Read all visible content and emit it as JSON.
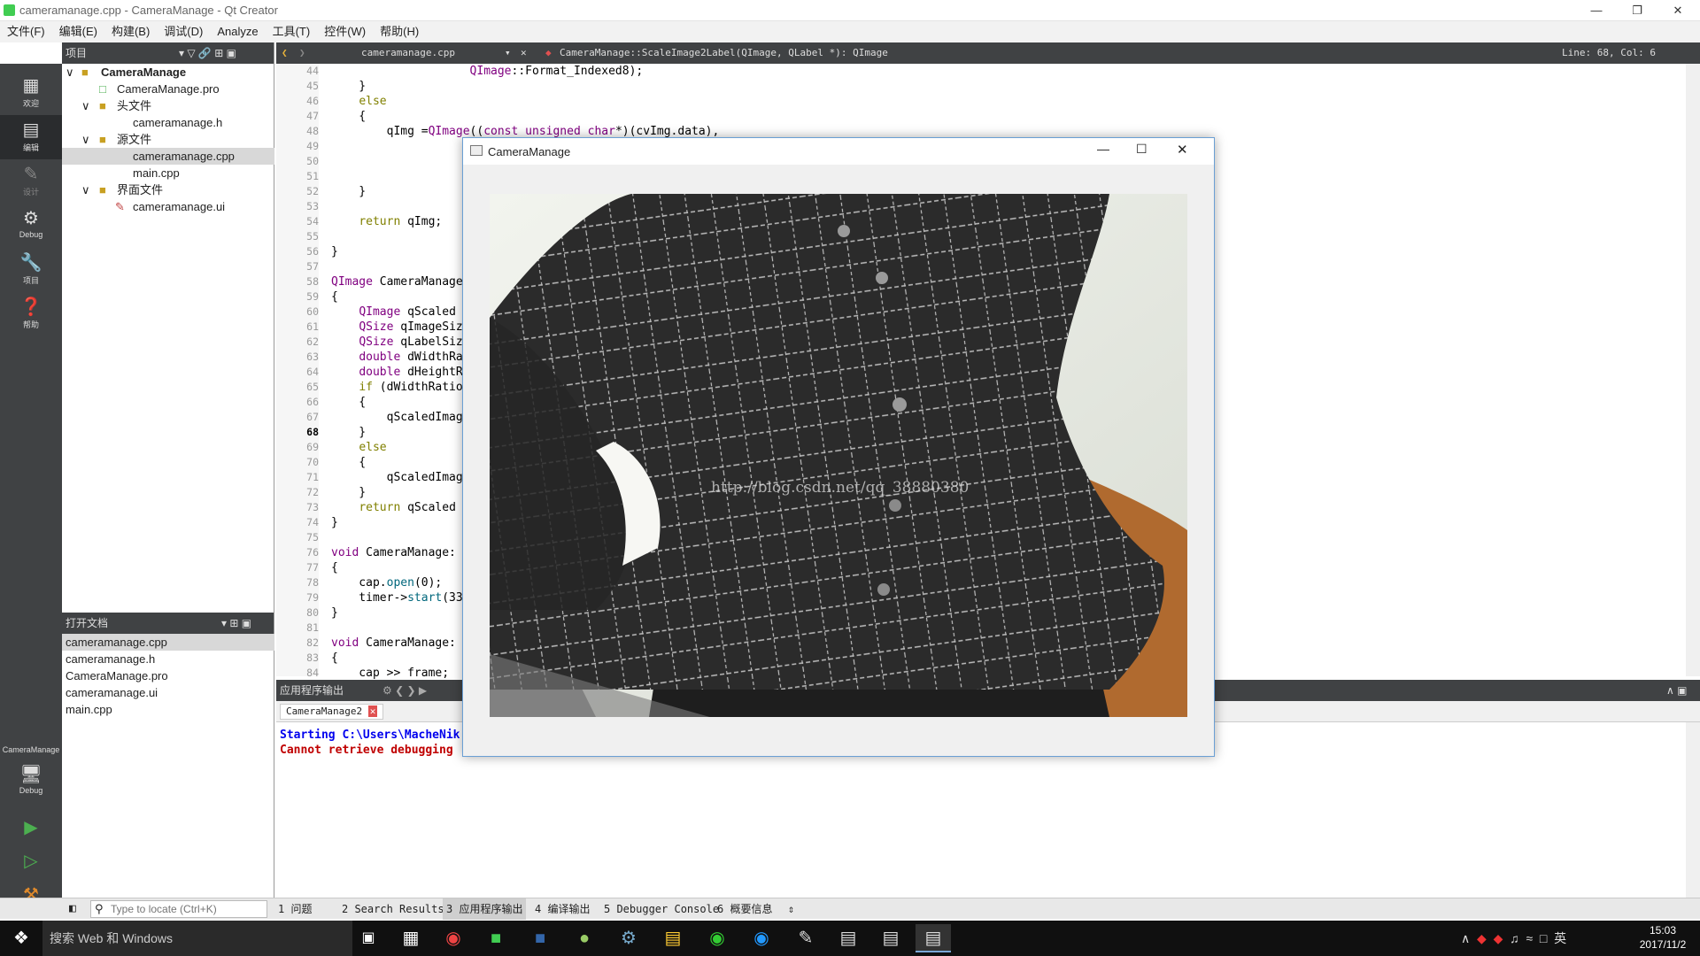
{
  "window": {
    "title": "cameramanage.cpp - CameraManage - Qt Creator"
  },
  "menu": [
    "文件(F)",
    "编辑(E)",
    "构建(B)",
    "调试(D)",
    "Analyze",
    "工具(T)",
    "控件(W)",
    "帮助(H)"
  ],
  "modes": [
    {
      "label": "欢迎",
      "icon": "grid-icon"
    },
    {
      "label": "编辑",
      "icon": "edit-icon"
    },
    {
      "label": "设计",
      "icon": "pencil-icon"
    },
    {
      "label": "Debug",
      "icon": "bug-icon"
    },
    {
      "label": "项目",
      "icon": "wrench-icon"
    },
    {
      "label": "帮助",
      "icon": "help-icon"
    }
  ],
  "kit": {
    "project": "CameraManage",
    "config": "Debug"
  },
  "project_pane": {
    "title": "项目",
    "tree": [
      {
        "label": "CameraManage",
        "level": 0
      },
      {
        "label": "CameraManage.pro",
        "level": 1
      },
      {
        "label": "头文件",
        "level": 1
      },
      {
        "label": "cameramanage.h",
        "level": 2
      },
      {
        "label": "源文件",
        "level": 1
      },
      {
        "label": "cameramanage.cpp",
        "level": 2
      },
      {
        "label": "main.cpp",
        "level": 2
      },
      {
        "label": "界面文件",
        "level": 1
      },
      {
        "label": "cameramanage.ui",
        "level": 2
      }
    ]
  },
  "open_docs": {
    "title": "打开文档",
    "items": [
      "cameramanage.cpp",
      "cameramanage.h",
      "CameraManage.pro",
      "cameramanage.ui",
      "main.cpp"
    ]
  },
  "editor": {
    "file": "cameramanage.cpp",
    "symbol": "CameraManage::ScaleImage2Label(QImage, QLabel *): QImage",
    "position": "Line: 68, Col: 6",
    "first_line": 44,
    "lines": [
      "                    QImage::Format_Indexed8);",
      "    }",
      "    else",
      "    {",
      "        qImg =QImage((const unsigned char*)(cvImg.data),",
      "",
      "",
      "",
      "    }",
      "",
      "    return qImg;",
      "",
      "}",
      "",
      "QImage CameraManage",
      "{",
      "    QImage qScaled",
      "    QSize qImageSiz",
      "    QSize qLabelSiz",
      "    double dWidthRa",
      "    double dHeightR",
      "    if (dWidthRatio",
      "    {",
      "        qScaledImag",
      "    }",
      "    else",
      "    {",
      "        qScaledImag",
      "    }",
      "    return qScaled",
      "}",
      "",
      "void CameraManage:",
      "{",
      "    cap.open(0);",
      "    timer->start(33",
      "}",
      "",
      "void CameraManage:",
      "{",
      "    cap >> frame;"
    ]
  },
  "output": {
    "title": "应用程序输出",
    "tab": "CameraManage2",
    "lines": [
      "Starting C:\\Users\\MacheNik",
      "Cannot retrieve debugging"
    ]
  },
  "bottom_tabs": [
    "1 问题",
    "2 Search Results",
    "3 应用程序输出",
    "4 编译输出",
    "5 Debugger Console",
    "6 概要信息"
  ],
  "locator": {
    "placeholder": "Type to locate (Ctrl+K)"
  },
  "app": {
    "title": "CameraManage",
    "watermark": "http://blog.csdn.net/qq_38880380"
  },
  "taskbar": {
    "search": "搜索 Web 和 Windows",
    "time": "15:03",
    "date": "2017/11/2",
    "ime": "英"
  }
}
